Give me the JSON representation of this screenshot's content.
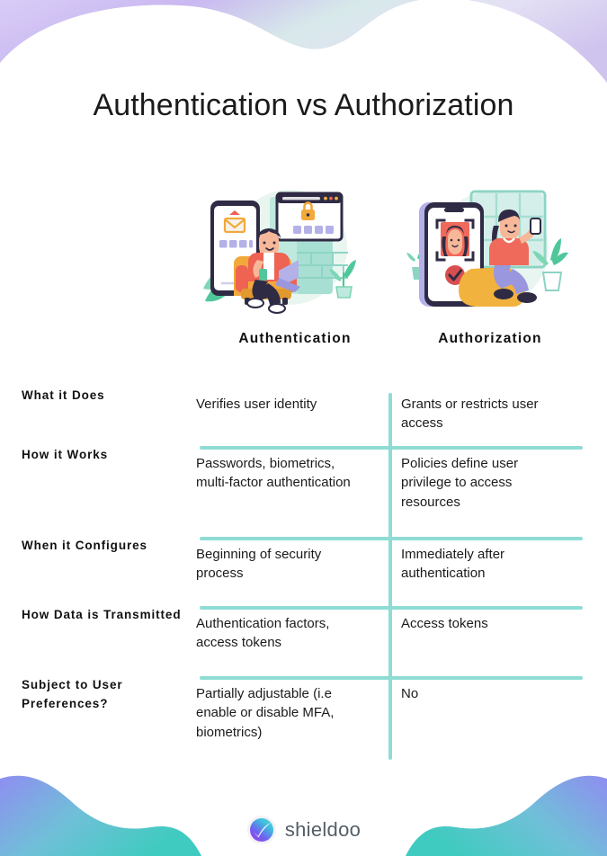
{
  "page": {
    "title": "Authentication vs Authorization",
    "accent_line_color": "#8fdcd5",
    "top_deco_color": "#c9b8f0",
    "bottom_deco_colors": [
      "#8f8ef0",
      "#3fcbbf"
    ]
  },
  "columns": [
    {
      "id": "authentication",
      "label": "Authentication",
      "illustration": "person-in-armchair-with-phone-and-laptop-login-illustration"
    },
    {
      "id": "authorization",
      "label": "Authorization",
      "illustration": "woman-on-beanbag-face-id-verification-illustration"
    }
  ],
  "rows": [
    {
      "label": "What it Does",
      "authentication": "Verifies user identity",
      "authorization": "Grants or restricts user access"
    },
    {
      "label": "How it Works",
      "authentication": "Passwords, biometrics, multi-factor authentication",
      "authorization": "Policies define user privilege to access resources"
    },
    {
      "label": "When it Configures",
      "authentication": "Beginning of security process",
      "authorization": "Immediately after authentication"
    },
    {
      "label": "How Data is Transmitted",
      "authentication": "Authentication factors, access tokens",
      "authorization": "Access tokens"
    },
    {
      "label": "Subject to User Preferences?",
      "authentication": "Partially adjustable (i.e enable or disable MFA, biometrics)",
      "authorization": "No"
    }
  ],
  "footer": {
    "brand": "shieldoo",
    "logo_icon": "shieldoo-gradient-sphere-logo"
  }
}
